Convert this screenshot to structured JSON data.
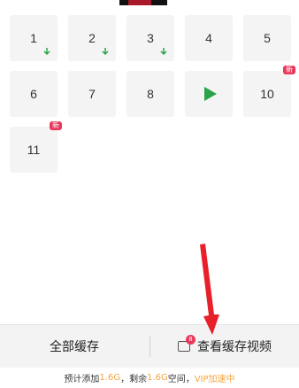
{
  "episodes": [
    {
      "number": "1",
      "status": "downloading"
    },
    {
      "number": "2",
      "status": "downloading"
    },
    {
      "number": "3",
      "status": "downloading"
    },
    {
      "number": "4",
      "status": "none"
    },
    {
      "number": "5",
      "status": "none"
    },
    {
      "number": "6",
      "status": "none"
    },
    {
      "number": "7",
      "status": "none"
    },
    {
      "number": "8",
      "status": "none"
    },
    {
      "number": "",
      "status": "playing"
    },
    {
      "number": "10",
      "status": "new",
      "badge": "新"
    },
    {
      "number": "11",
      "status": "new",
      "badge": "新"
    }
  ],
  "bottom_bar": {
    "cache_all_label": "全部缓存",
    "view_cached_label": "查看缓存视频",
    "cached_count": "8"
  },
  "footer": {
    "prefix": "预计添加",
    "estimate": "1.6G",
    "middle": "，剩余",
    "remaining": "1.6G",
    "space_label": "空间，",
    "vip_label": "VIP加速中"
  },
  "colors": {
    "accent_red": "#e8385b",
    "download_green": "#2aa34a",
    "highlight_orange": "#f4a641"
  }
}
